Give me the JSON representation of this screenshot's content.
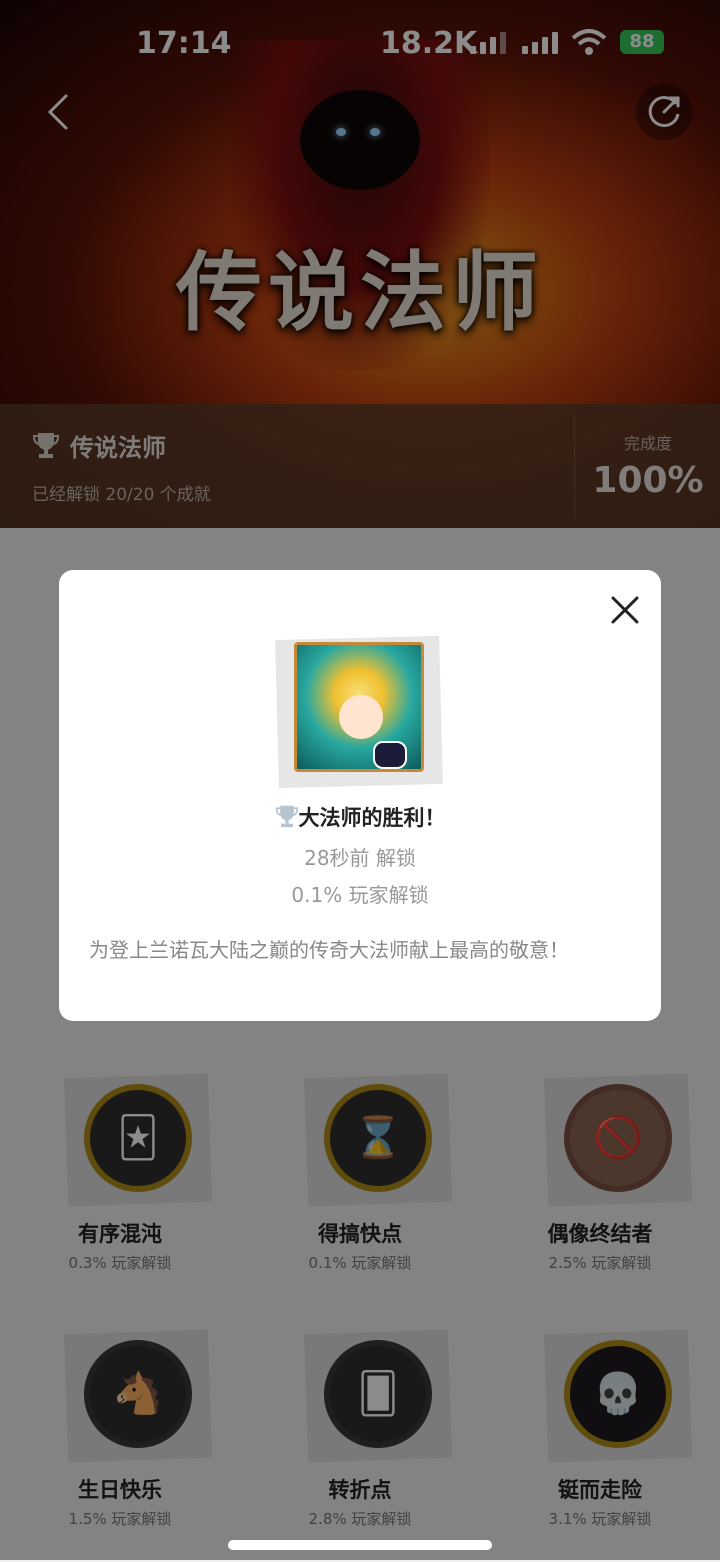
{
  "status_bar": {
    "time": "17:14",
    "network_speed": "18.2K",
    "battery": "88"
  },
  "header": {
    "game_logo_text": "传说法师"
  },
  "collection": {
    "title": "传说法师",
    "subtitle": "已经解锁 20/20 个成就",
    "progress_label": "完成度",
    "progress_value": "100%"
  },
  "achievements": [
    {
      "name": "有序混沌",
      "pct": "0.3% 玩家解锁",
      "icon": "tarot-card-icon"
    },
    {
      "name": "得搞快点",
      "pct": "0.1% 玩家解锁",
      "icon": "hourglass-icon"
    },
    {
      "name": "偶像终结者",
      "pct": "2.5% 玩家解锁",
      "icon": "easel-icon"
    },
    {
      "name": "生日快乐",
      "pct": "1.5% 玩家解锁",
      "icon": "pinata-icon"
    },
    {
      "name": "转折点",
      "pct": "2.8% 玩家解锁",
      "icon": "cards-icon"
    },
    {
      "name": "铤而走险",
      "pct": "3.1% 玩家解锁",
      "icon": "skull-flame-icon"
    }
  ],
  "modal": {
    "name": "大法师的胜利！",
    "time": "28秒前 解锁",
    "rate": "0.1% 玩家解锁",
    "description": "为登上兰诺瓦大陆之巅的传奇大法师献上最高的敬意！"
  }
}
